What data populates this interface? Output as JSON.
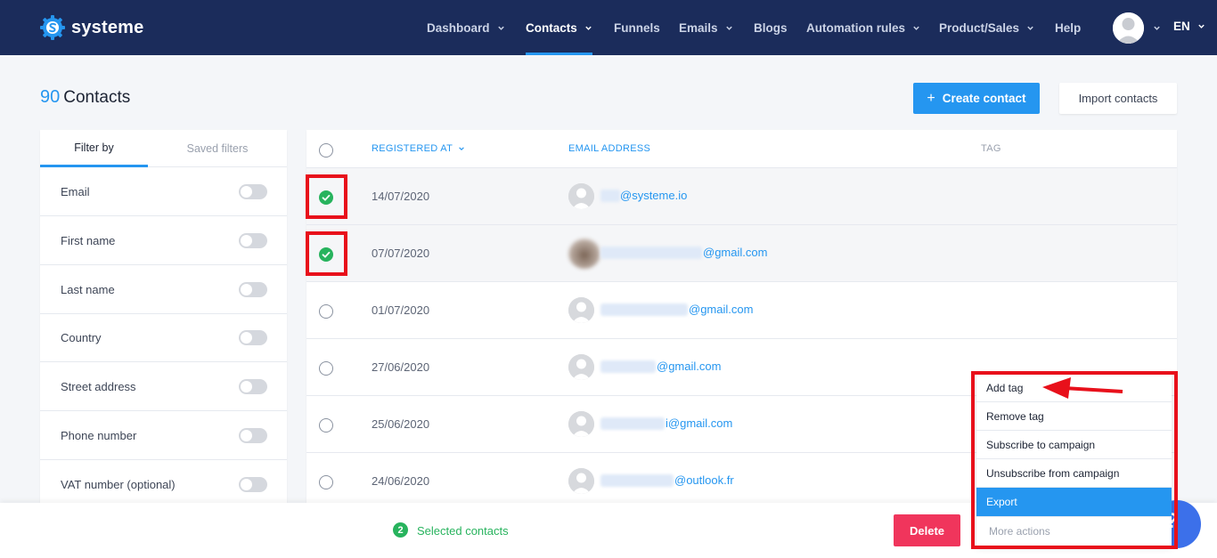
{
  "brand": {
    "name": "systeme"
  },
  "nav": {
    "items": [
      {
        "label": "Dashboard",
        "dropdown": true
      },
      {
        "label": "Contacts",
        "dropdown": true,
        "active": true
      },
      {
        "label": "Funnels",
        "dropdown": false
      },
      {
        "label": "Emails",
        "dropdown": true
      },
      {
        "label": "Blogs",
        "dropdown": false
      },
      {
        "label": "Automation rules",
        "dropdown": true
      },
      {
        "label": "Product/Sales",
        "dropdown": true
      },
      {
        "label": "Help",
        "dropdown": false
      }
    ],
    "language": "EN"
  },
  "page": {
    "count": "90",
    "title": "Contacts",
    "create_button": "Create contact",
    "import_button": "Import contacts"
  },
  "filters": {
    "tabs": {
      "active": "Filter by",
      "inactive": "Saved filters"
    },
    "fields": [
      "Email",
      "First name",
      "Last name",
      "Country",
      "Street address",
      "Phone number",
      "VAT number (optional)"
    ]
  },
  "table": {
    "columns": {
      "registered": "REGISTERED AT",
      "email": "EMAIL ADDRESS",
      "tag": "TAG"
    },
    "rows": [
      {
        "date": "14/07/2020",
        "email": "@systeme.io",
        "selected": true
      },
      {
        "date": "07/07/2020",
        "email": "@gmail.com",
        "selected": true
      },
      {
        "date": "01/07/2020",
        "email": "@gmail.com",
        "selected": false
      },
      {
        "date": "27/06/2020",
        "email": "@gmail.com",
        "selected": false
      },
      {
        "date": "25/06/2020",
        "email": "i@gmail.com",
        "selected": false
      },
      {
        "date": "24/06/2020",
        "email": "@outlook.fr",
        "selected": false
      }
    ]
  },
  "bottom": {
    "selected_count": "2",
    "selected_label": "Selected contacts",
    "delete_button": "Delete"
  },
  "actions_menu": {
    "items": [
      "Add tag",
      "Remove tag",
      "Subscribe to campaign",
      "Unsubscribe from campaign",
      "Export",
      "More actions"
    ],
    "highlighted": "Export"
  },
  "colors": {
    "nav_bg": "#1b2c5b",
    "accent": "#2596f0",
    "success": "#27b35d",
    "danger": "#f0355c",
    "annotation": "#e8101b"
  },
  "icons": [
    "systeme-logo-icon",
    "chevron-down-icon",
    "user-avatar-icon",
    "plus-icon",
    "check-icon",
    "sort-chevron-icon",
    "help-icon",
    "annotation-arrow-icon"
  ]
}
